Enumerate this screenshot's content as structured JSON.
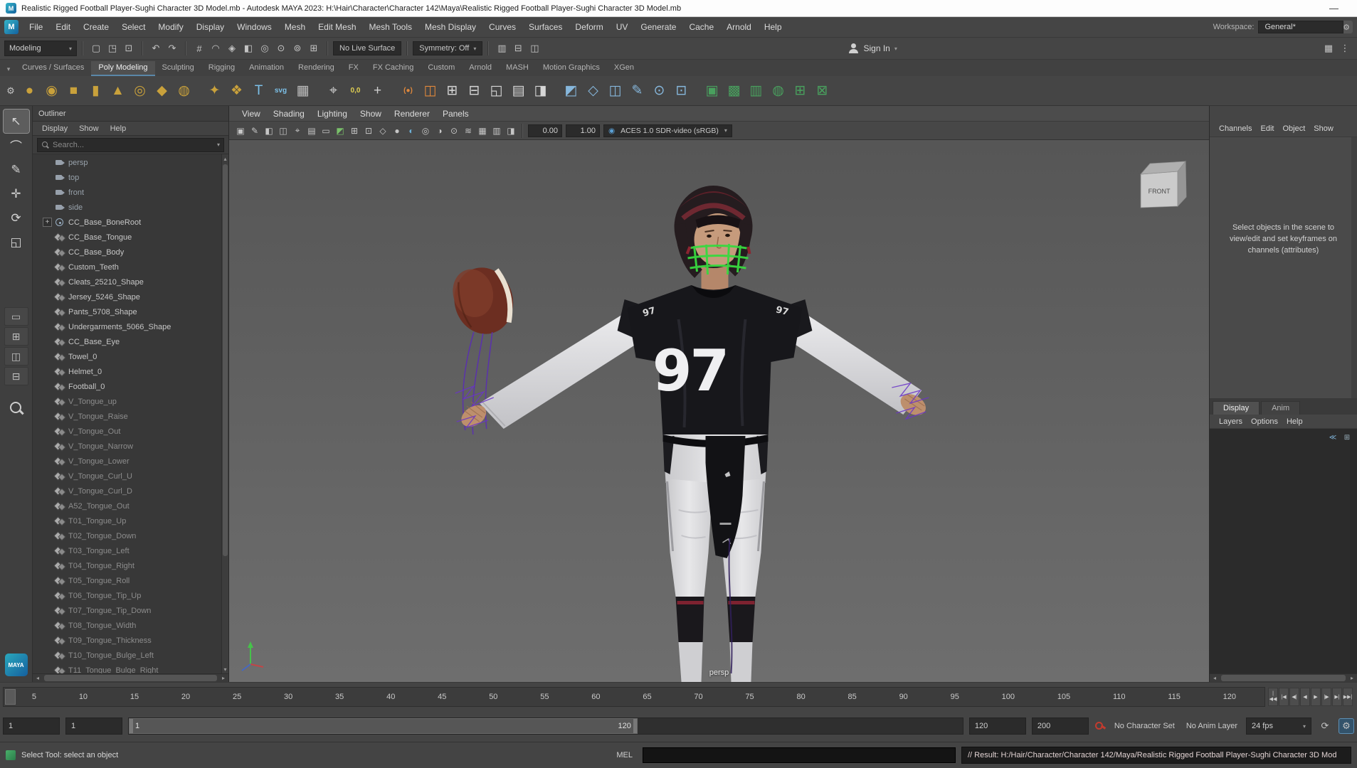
{
  "icons": {
    "app_logo": "M",
    "minimize": "—",
    "caret_down": "▾",
    "scroll_up": "▴",
    "scroll_down": "▾",
    "scroll_left": "◂",
    "scroll_right": "▸",
    "gear": "⚙",
    "loop": "⟳",
    "logo_text": "MAYA"
  },
  "title_bar": {
    "title": "Realistic Rigged Football Player-Sughi Character 3D Model.mb - Autodesk MAYA 2023: H:\\Hair\\Character\\Character 142\\Maya\\Realistic Rigged Football Player-Sughi Character 3D Model.mb"
  },
  "menu_bar": {
    "items": [
      "File",
      "Edit",
      "Create",
      "Select",
      "Modify",
      "Display",
      "Windows",
      "Mesh",
      "Edit Mesh",
      "Mesh Tools",
      "Mesh Display",
      "Curves",
      "Surfaces",
      "Deform",
      "UV",
      "Generate",
      "Cache",
      "Arnold",
      "Help"
    ],
    "workspace_label": "Workspace:",
    "workspace_value": "General*"
  },
  "status_line": {
    "mode": "Modeling",
    "file_icons": [
      {
        "n": "new-scene-icon",
        "g": "▢"
      },
      {
        "n": "open-scene-icon",
        "g": "◳"
      },
      {
        "n": "save-scene-icon",
        "g": "⊡"
      }
    ],
    "undo_icons": [
      {
        "n": "undo-icon",
        "g": "↶"
      },
      {
        "n": "redo-icon",
        "g": "↷"
      }
    ],
    "snap_icons": [
      {
        "n": "snap-to-grid-icon",
        "g": "#"
      },
      {
        "n": "snap-to-curve-icon",
        "g": "◠"
      },
      {
        "n": "snap-to-point-icon",
        "g": "◈"
      },
      {
        "n": "snap-to-plane-icon",
        "g": "◧"
      },
      {
        "n": "make-live-icon",
        "g": "◎"
      },
      {
        "n": "snap-to-center-icon",
        "g": "⊙"
      },
      {
        "n": "snap-projected-icon",
        "g": "⊚"
      },
      {
        "n": "snap-view-plane-icon",
        "g": "⊞"
      }
    ],
    "live_surface": "No Live Surface",
    "symmetry": "Symmetry: Off",
    "history_icons": [
      {
        "n": "input-operations-icon",
        "g": "▥"
      },
      {
        "n": "construction-history-icon",
        "g": "⊟"
      },
      {
        "n": "render-settings-icon",
        "g": "◫"
      }
    ],
    "sign_in": "Sign In",
    "right_icons": [
      {
        "n": "panel-grid-icon",
        "g": "▦"
      },
      {
        "n": "more-options-icon",
        "g": "⋮"
      }
    ]
  },
  "shelf": {
    "tabs": [
      {
        "label": "Curves / Surfaces"
      },
      {
        "label": "Poly Modeling",
        "cls": "active"
      },
      {
        "label": "Sculpting"
      },
      {
        "label": "Rigging"
      },
      {
        "label": "Animation"
      },
      {
        "label": "Rendering"
      },
      {
        "label": "FX"
      },
      {
        "label": "FX Caching"
      },
      {
        "label": "Custom"
      },
      {
        "label": "Arnold"
      },
      {
        "label": "MASH"
      },
      {
        "label": "Motion Graphics"
      },
      {
        "label": "XGen"
      }
    ],
    "icons": [
      {
        "n": "poly-sphere-icon",
        "g": "●",
        "c": "#c9a13b"
      },
      {
        "n": "poly-sphere-uv-icon",
        "g": "◉",
        "c": "#c9a13b"
      },
      {
        "n": "poly-cube-icon",
        "g": "■",
        "c": "#c9a13b"
      },
      {
        "n": "poly-cylinder-icon",
        "g": "▮",
        "c": "#c9a13b"
      },
      {
        "n": "poly-cone-icon",
        "g": "▲",
        "c": "#c9a13b"
      },
      {
        "n": "poly-torus-icon",
        "g": "◎",
        "c": "#c9a13b"
      },
      {
        "n": "poly-plane-icon",
        "g": "◆",
        "c": "#c9a13b"
      },
      {
        "n": "poly-disc-icon",
        "g": "◍",
        "c": "#c9a13b"
      },
      {
        "cls": "sep"
      },
      {
        "n": "platonic-solid-icon",
        "g": "✦",
        "c": "#c9a13b"
      },
      {
        "n": "super-shape-icon",
        "g": "❖",
        "c": "#c9a13b"
      },
      {
        "n": "type-tool-icon",
        "g": "T",
        "c": "#7cc0e8"
      },
      {
        "n": "svg-tool-icon",
        "g": "svg",
        "c": "#7cc0e8",
        "cls": "txt"
      },
      {
        "n": "construction-grid-icon",
        "g": "▦",
        "c": "#bdbdbd"
      },
      {
        "cls": "sep"
      },
      {
        "n": "scene-camera-icon",
        "g": "⌖",
        "c": "#cfcfcf"
      },
      {
        "n": "origin-locator-icon",
        "g": "0,0",
        "c": "#e0cf52",
        "cls": "txt"
      },
      {
        "n": "distance-tool-icon",
        "g": "+",
        "c": "#cfcfcf"
      },
      {
        "cls": "sep"
      },
      {
        "n": "curve-brackets-icon",
        "g": "(●)",
        "c": "#e0883c",
        "cls": "txt"
      },
      {
        "n": "layered-shape-icon",
        "g": "◫",
        "c": "#e0883c"
      },
      {
        "n": "combine-mesh-icon",
        "g": "⊞",
        "c": "#d6d6d6"
      },
      {
        "n": "separate-mesh-icon",
        "g": "⊟",
        "c": "#d6d6d6"
      },
      {
        "n": "boolean-union-icon",
        "g": "◱",
        "c": "#d6d6d6"
      },
      {
        "n": "smooth-mesh-icon",
        "g": "▤",
        "c": "#d6d6d6"
      },
      {
        "n": "mirror-geometry-icon",
        "g": "◨",
        "c": "#d6d6d6"
      },
      {
        "cls": "sep"
      },
      {
        "n": "extrude-icon",
        "g": "◩",
        "c": "#86b7dc"
      },
      {
        "n": "bevel-icon",
        "g": "◇",
        "c": "#86b7dc"
      },
      {
        "n": "bridge-icon",
        "g": "◫",
        "c": "#86b7dc"
      },
      {
        "n": "multi-cut-icon",
        "g": "✎",
        "c": "#86b7dc"
      },
      {
        "n": "target-weld-icon",
        "g": "⊙",
        "c": "#86b7dc"
      },
      {
        "n": "quad-draw-icon",
        "g": "⊡",
        "c": "#86b7dc"
      },
      {
        "cls": "sep"
      },
      {
        "n": "uv-planar-icon",
        "g": "▣",
        "c": "#49a05e"
      },
      {
        "n": "uv-automatic-icon",
        "g": "▩",
        "c": "#49a05e"
      },
      {
        "n": "uv-cylindrical-icon",
        "g": "▥",
        "c": "#49a05e"
      },
      {
        "n": "uv-spherical-icon",
        "g": "◍",
        "c": "#49a05e"
      },
      {
        "n": "uv-editor-icon",
        "g": "⊞",
        "c": "#49a05e"
      },
      {
        "n": "uv-snapshot-icon",
        "g": "⊠",
        "c": "#49a05e"
      }
    ]
  },
  "toolbox": {
    "tools": [
      {
        "n": "select-tool",
        "g": "↖",
        "cls": "active"
      },
      {
        "n": "lasso-select-tool",
        "g": "⌒"
      },
      {
        "n": "paint-select-tool",
        "g": "✎"
      },
      {
        "n": "move-tool",
        "g": "✛"
      },
      {
        "n": "rotate-tool",
        "g": "⟳"
      },
      {
        "n": "scale-tool",
        "g": "◱"
      }
    ],
    "layouts": [
      {
        "n": "single-pane-layout-button",
        "g": "▭"
      },
      {
        "n": "four-pane-layout-button",
        "g": "⊞"
      },
      {
        "n": "two-pane-side-layout-button",
        "g": "◫"
      },
      {
        "n": "two-pane-stacked-layout-button",
        "g": "⊟"
      }
    ]
  },
  "outliner": {
    "title": "Outliner",
    "menus": [
      "Display",
      "Show",
      "Help"
    ],
    "search_placeholder": "Search...",
    "items": [
      {
        "label": "persp",
        "icon": "camera",
        "cls": "dim2"
      },
      {
        "label": "top",
        "icon": "camera",
        "cls": "dim2"
      },
      {
        "label": "front",
        "icon": "camera",
        "cls": "dim2"
      },
      {
        "label": "side",
        "icon": "camera",
        "cls": "dim2"
      },
      {
        "label": "CC_Base_BoneRoot",
        "icon": "joint",
        "exp": "+"
      },
      {
        "label": "CC_Base_Tongue",
        "icon": "mesh"
      },
      {
        "label": "CC_Base_Body",
        "icon": "mesh"
      },
      {
        "label": "Custom_Teeth",
        "icon": "mesh"
      },
      {
        "label": "Cleats_25210_Shape",
        "icon": "mesh"
      },
      {
        "label": "Jersey_5246_Shape",
        "icon": "mesh"
      },
      {
        "label": "Pants_5708_Shape",
        "icon": "mesh"
      },
      {
        "label": "Undergarments_5066_Shape",
        "icon": "mesh"
      },
      {
        "label": "CC_Base_Eye",
        "icon": "mesh"
      },
      {
        "label": "Towel_0",
        "icon": "mesh"
      },
      {
        "label": "Helmet_0",
        "icon": "mesh"
      },
      {
        "label": "Football_0",
        "icon": "mesh"
      },
      {
        "label": "V_Tongue_up",
        "icon": "mesh",
        "cls": "dim"
      },
      {
        "label": "V_Tongue_Raise",
        "icon": "mesh",
        "cls": "dim"
      },
      {
        "label": "V_Tongue_Out",
        "icon": "mesh",
        "cls": "dim"
      },
      {
        "label": "V_Tongue_Narrow",
        "icon": "mesh",
        "cls": "dim"
      },
      {
        "label": "V_Tongue_Lower",
        "icon": "mesh",
        "cls": "dim"
      },
      {
        "label": "V_Tongue_Curl_U",
        "icon": "mesh",
        "cls": "dim"
      },
      {
        "label": "V_Tongue_Curl_D",
        "icon": "mesh",
        "cls": "dim"
      },
      {
        "label": "A52_Tongue_Out",
        "icon": "mesh",
        "cls": "dim"
      },
      {
        "label": "T01_Tongue_Up",
        "icon": "mesh",
        "cls": "dim"
      },
      {
        "label": "T02_Tongue_Down",
        "icon": "mesh",
        "cls": "dim"
      },
      {
        "label": "T03_Tongue_Left",
        "icon": "mesh",
        "cls": "dim"
      },
      {
        "label": "T04_Tongue_Right",
        "icon": "mesh",
        "cls": "dim"
      },
      {
        "label": "T05_Tongue_Roll",
        "icon": "mesh",
        "cls": "dim"
      },
      {
        "label": "T06_Tongue_Tip_Up",
        "icon": "mesh",
        "cls": "dim"
      },
      {
        "label": "T07_Tongue_Tip_Down",
        "icon": "mesh",
        "cls": "dim"
      },
      {
        "label": "T08_Tongue_Width",
        "icon": "mesh",
        "cls": "dim"
      },
      {
        "label": "T09_Tongue_Thickness",
        "icon": "mesh",
        "cls": "dim"
      },
      {
        "label": "T10_Tongue_Bulge_Left",
        "icon": "mesh",
        "cls": "dim"
      },
      {
        "label": "T11_Tongue_Bulge_Right",
        "icon": "mesh",
        "cls": "dim"
      }
    ]
  },
  "viewport": {
    "menus": [
      "View",
      "Shading",
      "Lighting",
      "Show",
      "Renderer",
      "Panels"
    ],
    "toolbar_icons": [
      {
        "n": "select-highlight-icon",
        "g": "▣"
      },
      {
        "n": "grease-pencil-icon",
        "g": "✎"
      },
      {
        "n": "camera-lock-icon",
        "g": "◧"
      },
      {
        "n": "image-plane-icon",
        "g": "◫"
      },
      {
        "n": "bookmarks-icon",
        "g": "⌖"
      },
      {
        "n": "field-chart-icon",
        "g": "▤"
      },
      {
        "n": "resolution-gate-icon",
        "g": "▭"
      },
      {
        "n": "gate-mask-icon",
        "g": "◩",
        "c": "#79c06a"
      },
      {
        "n": "safe-action-icon",
        "g": "⊞"
      },
      {
        "n": "safe-title-icon",
        "g": "⊡"
      },
      {
        "n": "wireframe-mode-icon",
        "g": "◇"
      },
      {
        "n": "shaded-mode-icon",
        "g": "●"
      },
      {
        "n": "textured-mode-icon",
        "g": "◐",
        "c": "#6db1d8"
      },
      {
        "n": "lights-mode-icon",
        "g": "◎"
      },
      {
        "n": "shadows-toggle-icon",
        "g": "◑"
      },
      {
        "n": "ambient-occlusion-icon",
        "g": "⊙"
      },
      {
        "n": "motion-blur-icon",
        "g": "≋"
      },
      {
        "n": "anti-alias-icon",
        "g": "▦"
      },
      {
        "n": "depth-peel-icon",
        "g": "▥"
      },
      {
        "n": "isolate-select-icon",
        "g": "◨"
      }
    ],
    "exposure": "0.00",
    "gamma": "1.00",
    "cm_icon": "◉",
    "colorspace": "ACES 1.0 SDR-video (sRGB)",
    "view_cube_label": "FRONT",
    "jersey_number": "97",
    "camera_label": "persp"
  },
  "channel_box": {
    "menus": [
      "Channels",
      "Edit",
      "Object",
      "Show"
    ],
    "hint": "Select objects in the scene to view/edit and set keyframes on channels (attributes)",
    "tabs": [
      {
        "label": "Display",
        "cls": "active"
      },
      {
        "label": "Anim"
      }
    ],
    "layer_menus": [
      "Layers",
      "Options",
      "Help"
    ],
    "layer_icons": [
      {
        "n": "move-layer-up-icon",
        "g": "≪",
        "c": "#7fb3d9"
      },
      {
        "n": "new-layer-icon",
        "g": "⊞",
        "c": "#9ab0bd"
      }
    ]
  },
  "time_slider": {
    "ticks": [
      "5",
      "10",
      "15",
      "20",
      "25",
      "30",
      "35",
      "40",
      "45",
      "50",
      "55",
      "60",
      "65",
      "70",
      "75",
      "80",
      "85",
      "90",
      "95",
      "100",
      "105",
      "110",
      "115",
      "120"
    ],
    "playback": [
      {
        "n": "go-to-start-button",
        "g": "|◀◀"
      },
      {
        "n": "step-back-frame-button",
        "g": "|◀"
      },
      {
        "n": "step-back-key-button",
        "g": "◀|"
      },
      {
        "n": "play-backwards-button",
        "g": "◀"
      },
      {
        "n": "play-forwards-button",
        "g": "▶"
      },
      {
        "n": "step-forward-key-button",
        "g": "|▶"
      },
      {
        "n": "step-forward-frame-button",
        "g": "▶|"
      },
      {
        "n": "go-to-end-button",
        "g": "▶▶|"
      }
    ]
  },
  "range_slider": {
    "anim_start": "1",
    "playback_start": "1",
    "range_start_label": "1",
    "range_end_label": "120",
    "playback_end": "120",
    "anim_end": "200",
    "character_set": "No Character Set",
    "anim_layer": "No Anim Layer",
    "fps": "24 fps"
  },
  "command_line": {
    "mel_label": "MEL",
    "result": "// Result: H:/Hair/Character/Character 142/Maya/Realistic Rigged Football Player-Sughi Character 3D Mod"
  },
  "help_line": {
    "text": "Select Tool: select an object"
  }
}
